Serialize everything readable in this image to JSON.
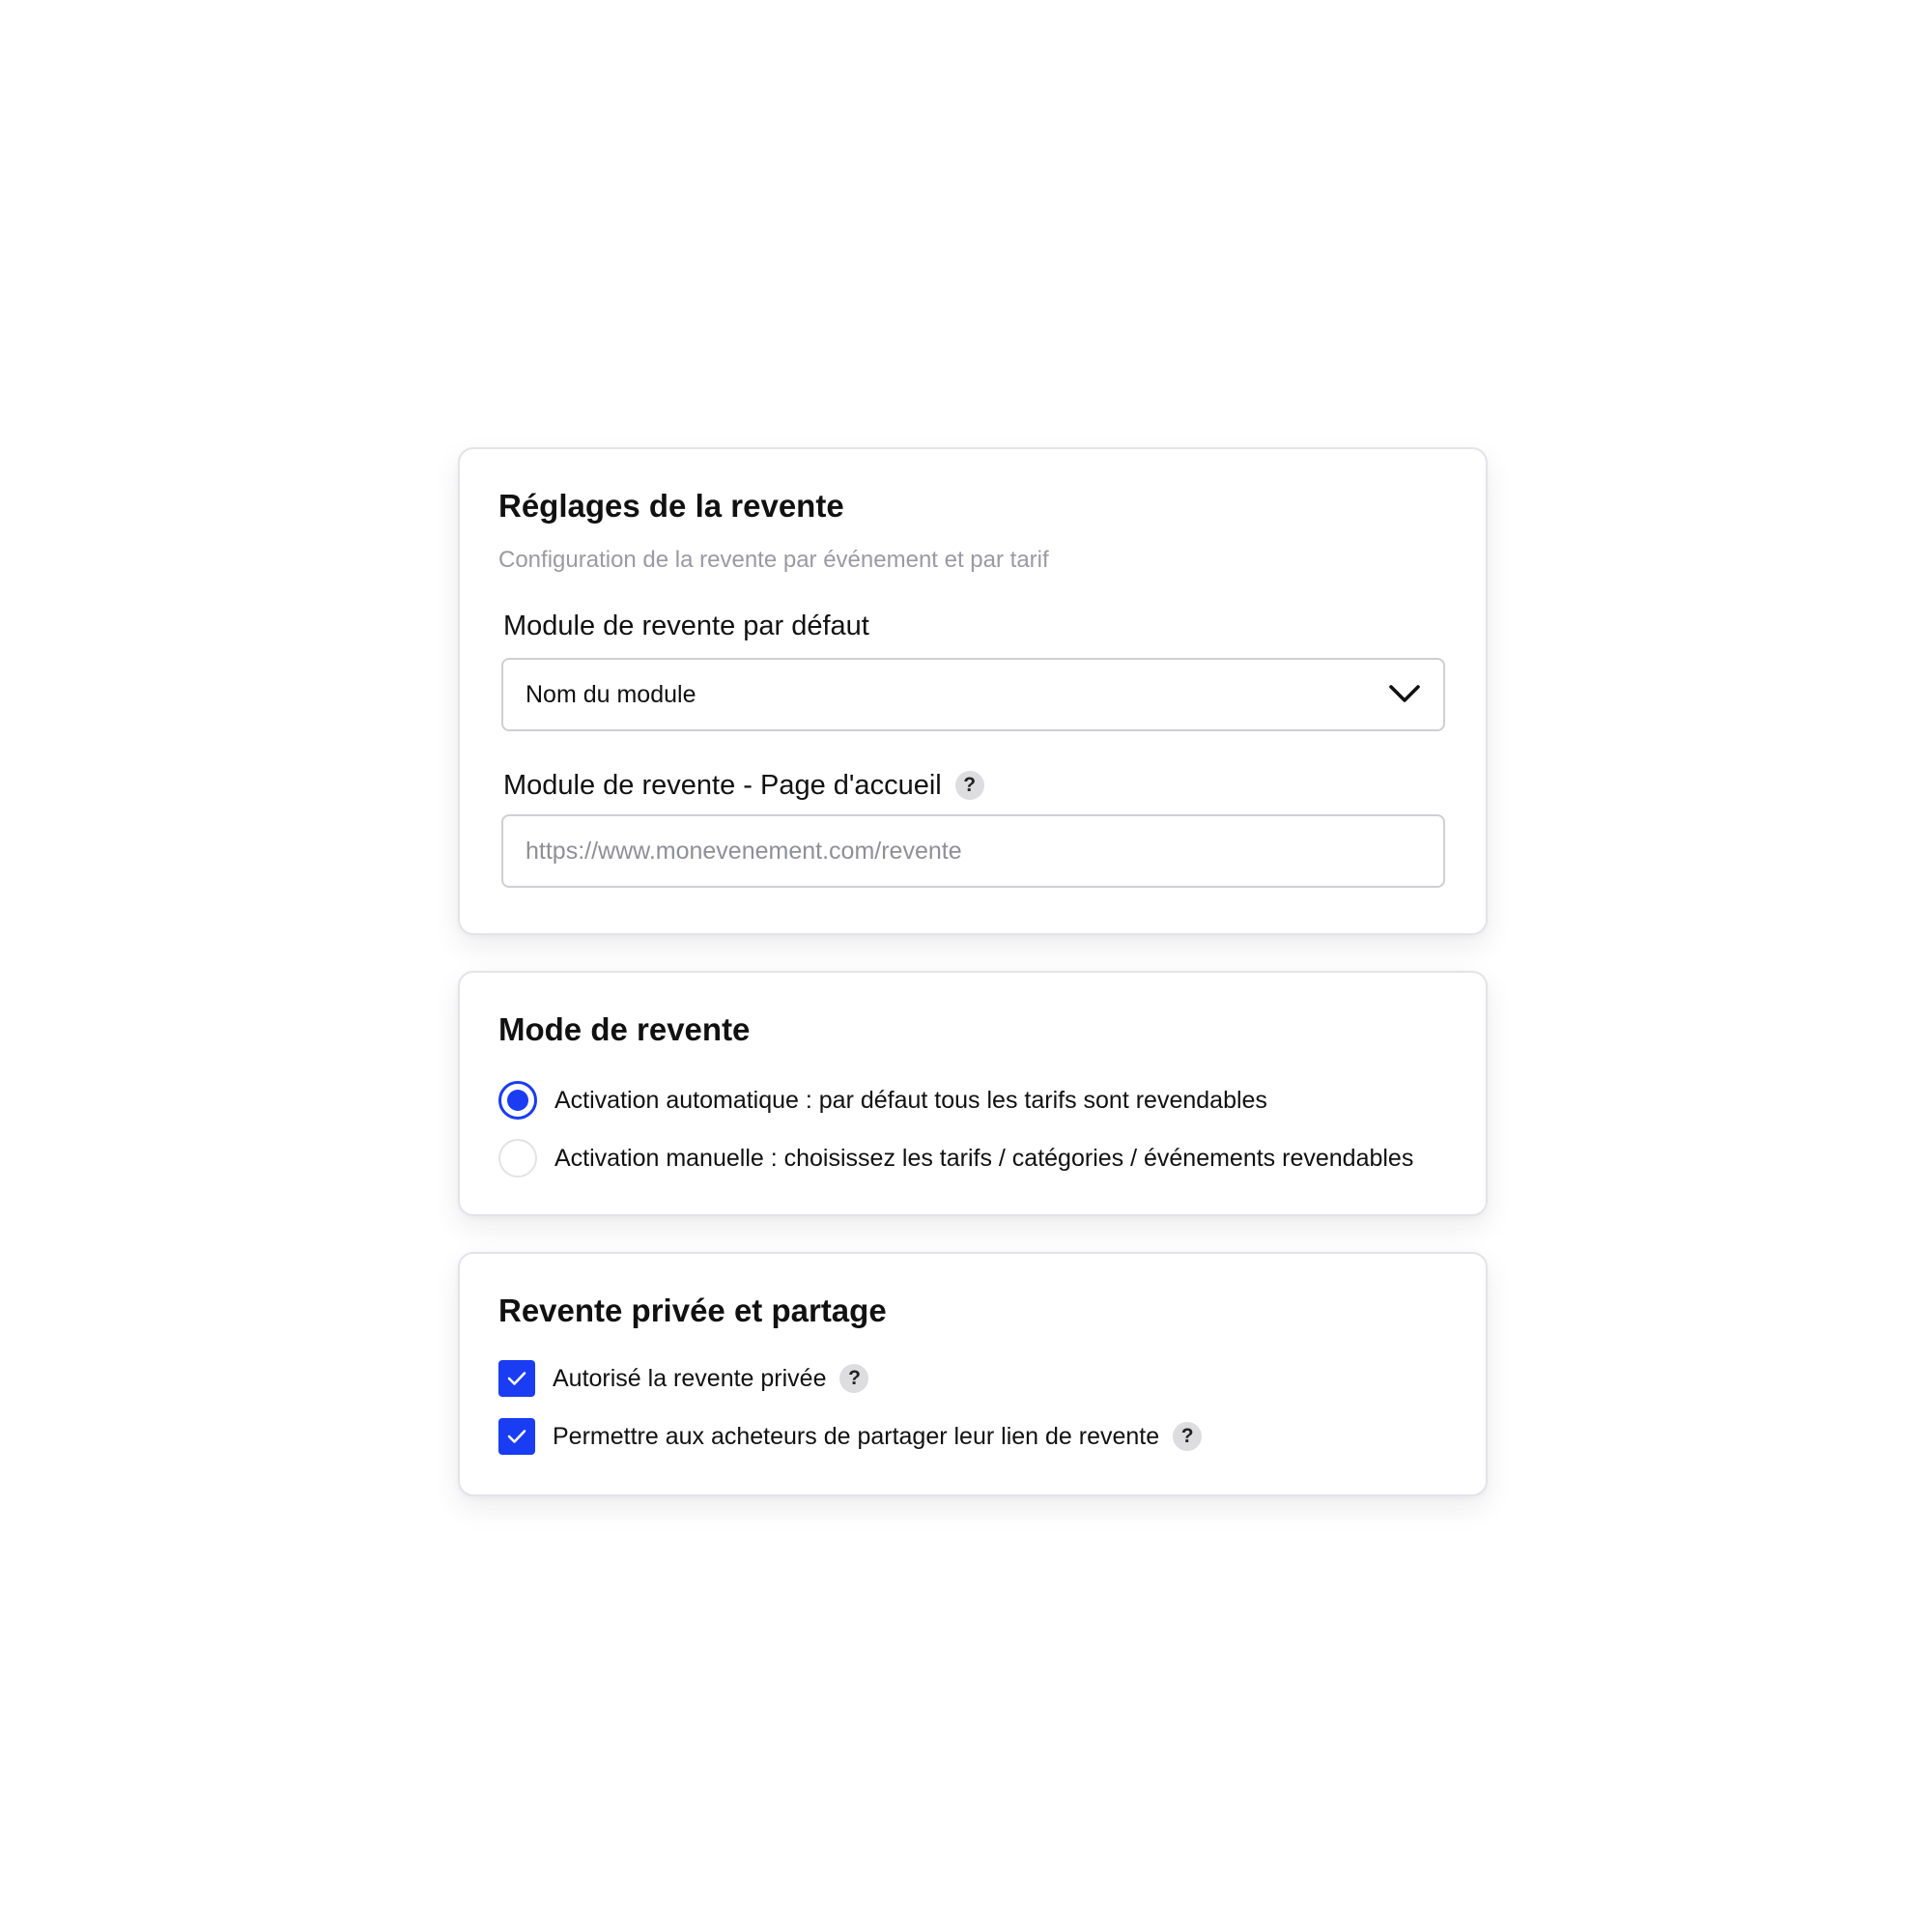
{
  "settings": {
    "title": "Réglages de la revente",
    "subtitle": "Configuration de la revente par événement et par tarif",
    "default_module": {
      "label": "Module de revente par défaut",
      "selected": "Nom du module"
    },
    "home_page": {
      "label": "Module de revente - Page d'accueil",
      "help": "?",
      "value": "",
      "placeholder": "https://www.monevenement.com/revente"
    }
  },
  "mode": {
    "title": "Mode de revente",
    "options": [
      {
        "label": "Activation automatique : par défaut tous les tarifs sont revendables",
        "selected": true
      },
      {
        "label": "Activation manuelle : choisissez les tarifs / catégories / événements revendables",
        "selected": false
      }
    ]
  },
  "private": {
    "title": "Revente privée et partage",
    "options": [
      {
        "label": "Autorisé la revente privée",
        "checked": true,
        "help": "?"
      },
      {
        "label": "Permettre aux acheteurs de partager leur lien de revente",
        "checked": true,
        "help": "?"
      }
    ]
  },
  "colors": {
    "accent": "#1a3cf2",
    "border": "#cfcfd4",
    "subtitle": "#9a9aa2"
  }
}
